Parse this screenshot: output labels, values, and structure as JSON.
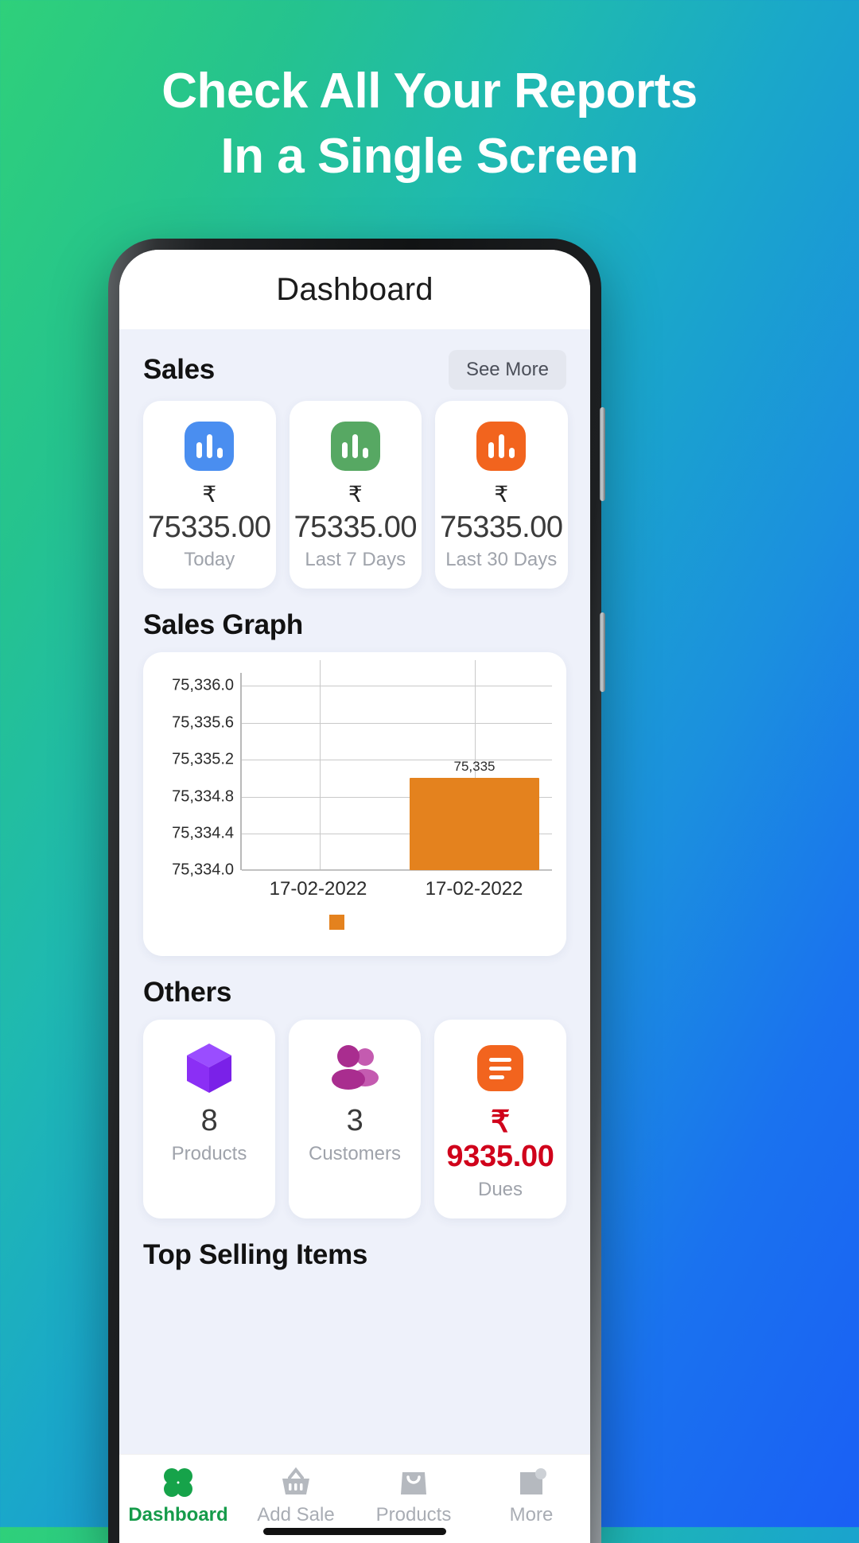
{
  "promo": {
    "line1": "Check All Your Reports",
    "line2": "In a Single Screen"
  },
  "colors": {
    "today_icon": "#4a8ef0",
    "last7_icon": "#57a863",
    "last30_icon": "#f2641e",
    "bar": "#e4821e",
    "products_icon": "#8b2ff5",
    "customers_icon": "#b53a9a",
    "dues_icon": "#f2641e",
    "dues_text": "#d0021b",
    "active_nav": "#159b4a"
  },
  "appbar": {
    "title": "Dashboard"
  },
  "sales": {
    "section_title": "Sales",
    "see_more_label": "See More",
    "cards": [
      {
        "icon": "bar-chart-icon",
        "currency": "₹",
        "value": "75335.00",
        "label": "Today"
      },
      {
        "icon": "bar-chart-icon",
        "currency": "₹",
        "value": "75335.00",
        "label": "Last 7 Days"
      },
      {
        "icon": "bar-chart-icon",
        "currency": "₹",
        "value": "75335.00",
        "label": "Last 30 Days"
      }
    ]
  },
  "sales_graph": {
    "section_title": "Sales Graph"
  },
  "chart_data": {
    "type": "bar",
    "title": "Sales Graph",
    "xlabel": "",
    "ylabel": "",
    "categories": [
      "17-02-2022",
      "17-02-2022"
    ],
    "values": [
      null,
      75335
    ],
    "data_labels": [
      "",
      "75,335"
    ],
    "ytick_labels": [
      "75,336.0",
      "75,335.6",
      "75,335.2",
      "75,334.8",
      "75,334.4",
      "75,334.0"
    ],
    "ytick_values": [
      75336.0,
      75335.6,
      75335.2,
      75334.8,
      75334.4,
      75334.0
    ],
    "ylim": [
      75334.0,
      75336.0
    ],
    "grid": true,
    "legend": "bottom",
    "series": [
      {
        "name": "",
        "color": "#e4821e",
        "values": [
          null,
          75335
        ]
      }
    ]
  },
  "others": {
    "section_title": "Others",
    "cards": [
      {
        "icon": "cube-icon",
        "value": "8",
        "label": "Products"
      },
      {
        "icon": "people-icon",
        "value": "3",
        "label": "Customers"
      },
      {
        "icon": "invoice-icon",
        "value": "₹ 9335.00",
        "label": "Dues"
      }
    ]
  },
  "top_selling": {
    "section_title": "Top Selling Items"
  },
  "bottom_nav": [
    {
      "icon": "clover-icon",
      "label": "Dashboard",
      "active": true
    },
    {
      "icon": "basket-icon",
      "label": "Add Sale",
      "active": false
    },
    {
      "icon": "bag-icon",
      "label": "Products",
      "active": false
    },
    {
      "icon": "more-icon",
      "label": "More",
      "active": false
    }
  ]
}
